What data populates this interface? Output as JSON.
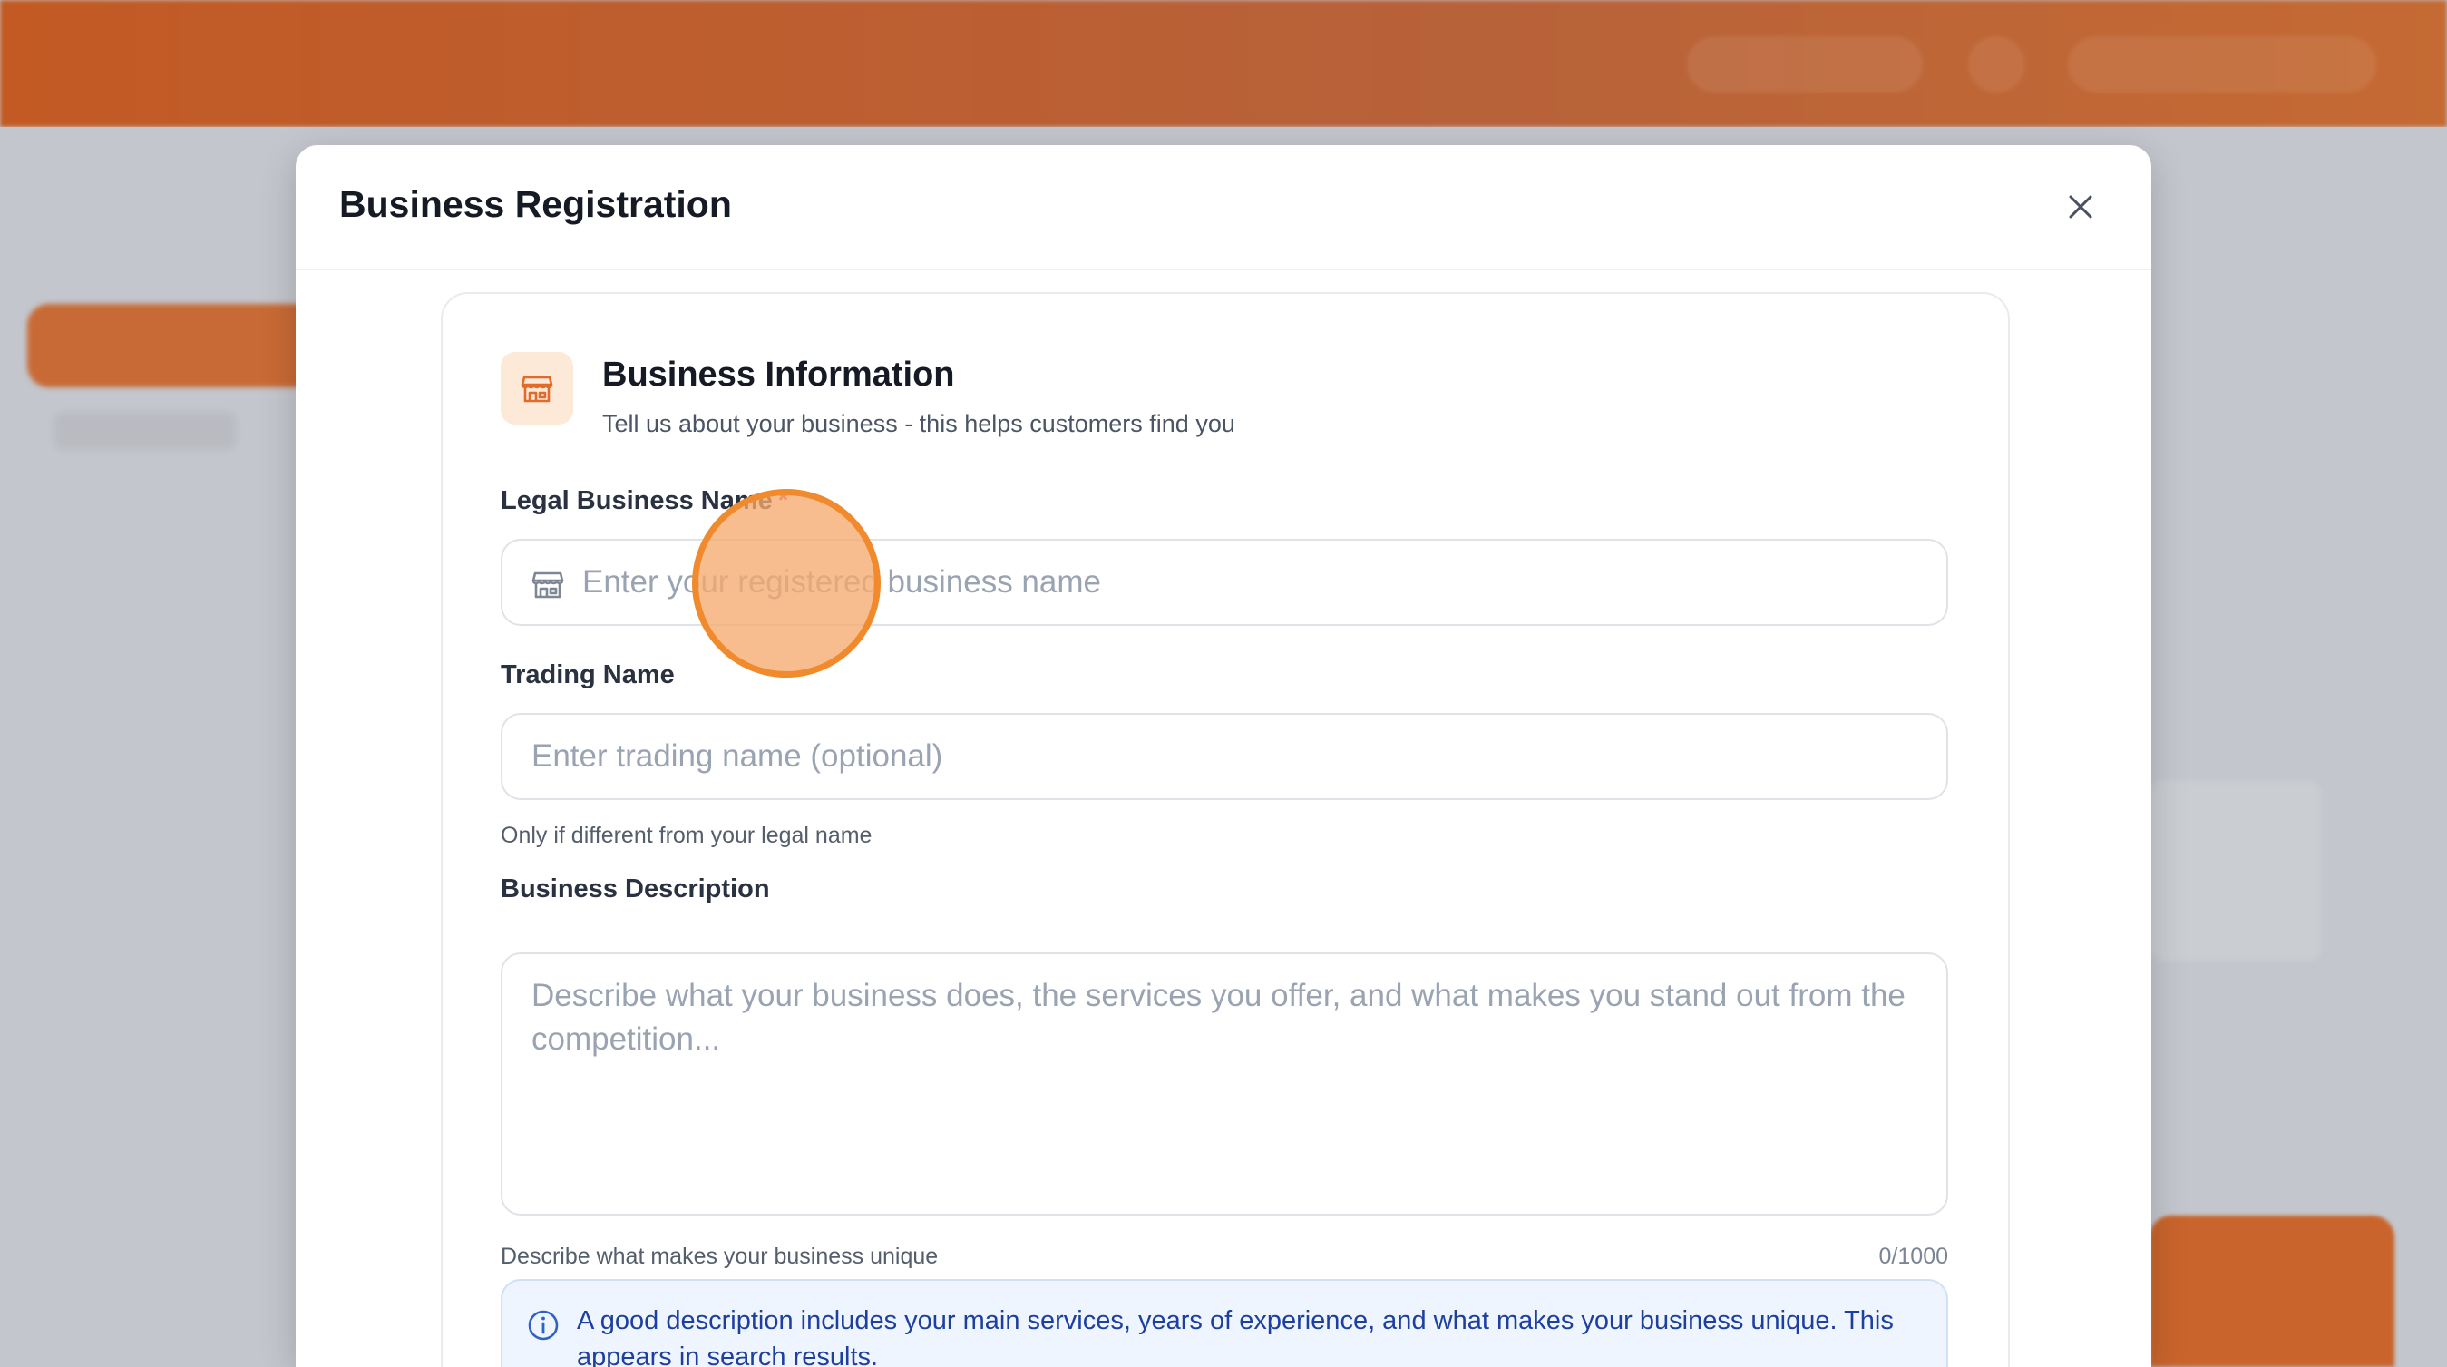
{
  "modal": {
    "title": "Business Registration",
    "close_icon": "close-icon"
  },
  "section": {
    "icon": "storefront-icon",
    "title": "Business Information",
    "subtitle": "Tell us about your business - this helps customers find you"
  },
  "fields": {
    "legal_name": {
      "label": "Legal Business Name",
      "required_mark": "*",
      "placeholder": "Enter your registered business name",
      "value": "",
      "icon": "storefront-icon"
    },
    "trading_name": {
      "label": "Trading Name",
      "placeholder": "Enter trading name (optional)",
      "value": "",
      "hint": "Only if different from your legal name"
    },
    "description": {
      "label": "Business Description",
      "placeholder": "Describe what your business does, the services you offer, and what makes you stand out from the competition...",
      "value": "",
      "hint": "Describe what makes your business unique",
      "counter": "0/1000"
    }
  },
  "info": {
    "icon": "info-icon",
    "text": "A good description includes your main services, years of experience, and what makes your business unique. This appears in search results."
  },
  "colors": {
    "accent": "#f08a2c",
    "info_text": "#1d3fa0",
    "info_bg": "#eef5fe"
  }
}
